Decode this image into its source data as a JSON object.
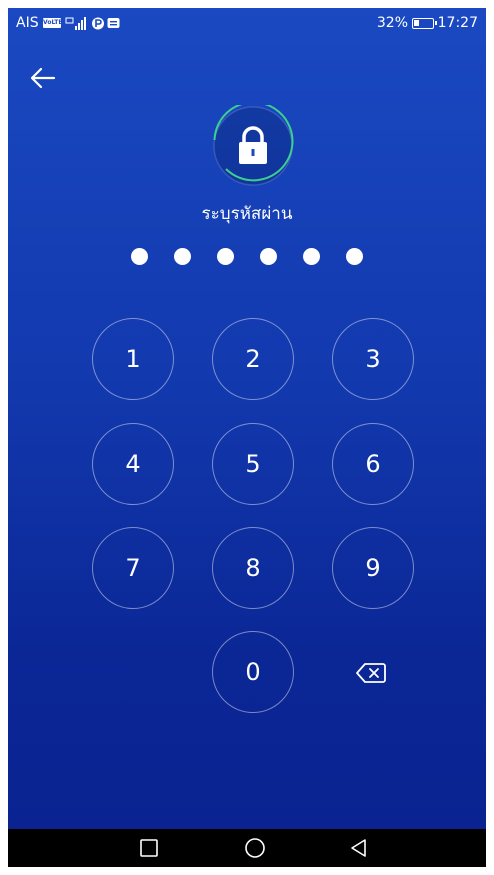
{
  "status_bar": {
    "carrier": "AIS",
    "volte": "VoLTE",
    "battery_percent": "32%",
    "battery_level": 0.32,
    "time": "17:27"
  },
  "prompt": "ระบุรหัสผ่าน",
  "pin": {
    "entered_count": 6
  },
  "keypad": [
    "1",
    "2",
    "3",
    "4",
    "5",
    "6",
    "7",
    "8",
    "9",
    "0"
  ],
  "icons": {
    "back": "arrow-left-icon",
    "lock": "lock-icon",
    "delete": "backspace-icon",
    "nav_recent": "square-icon",
    "nav_home": "circle-icon",
    "nav_back": "triangle-back-icon"
  },
  "colors": {
    "bg_top": "#1a49c2",
    "bg_bottom": "#0a2290",
    "ring": "#3ccf8e"
  }
}
